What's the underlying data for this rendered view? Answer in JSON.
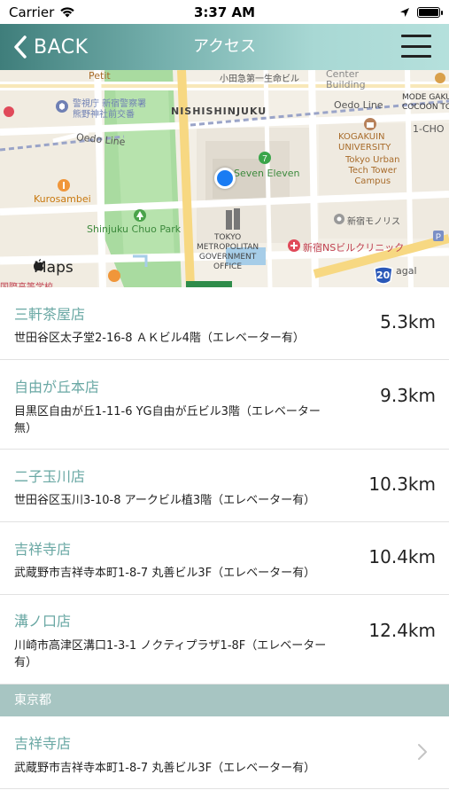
{
  "status_bar": {
    "carrier": "Carrier",
    "time": "3:37 AM"
  },
  "header": {
    "back_label": "BACK",
    "title": "アクセス"
  },
  "map": {
    "labels": {
      "petit": "Petit",
      "odakyu": "小田急第一生命ビル",
      "center_building": "Center\nBuilding",
      "mode_gakuen": "MODE GAKU\nCOCOON TO",
      "keishicho": "警視庁 新宿警察署\n熊野神社前交番",
      "nishishinjuku": "NISHISHINJUKU",
      "oedo_line_top": "Oedo Line",
      "one_cho": "1-CHO",
      "oedo_line_left": "Oedo Line",
      "kogakuin": "KOGAKUIN\nUNIVERSITY",
      "tokyo_urban": "Tokyo Urban\nTech Tower\nCampus",
      "seven_eleven": "Seven Eleven",
      "kurosambei": "Kurosambei",
      "chuo_park": "Shinjuku Chuo Park",
      "monolith": "新宿モノリス",
      "tmg": "TOKYO\nMETROPOLITAN\nGOVERNMENT\nOFFICE",
      "ns_clinic": "新宿NSビルクリニック",
      "agal": "agal",
      "left_bottom": "国際高等学校",
      "route_number": "20"
    },
    "attribution": "Maps"
  },
  "stores": [
    {
      "name": "三軒茶屋店",
      "address": "世田谷区太子堂2-16-8 ＡＫビル4階（エレベーター有）",
      "distance": "5.3km"
    },
    {
      "name": "自由が丘本店",
      "address": "目黒区自由が丘1-11-6 YG自由が丘ビル3階（エレベーター無）",
      "distance": "9.3km"
    },
    {
      "name": "二子玉川店",
      "address": "世田谷区玉川3-10-8 アークビル植3階（エレベーター有）",
      "distance": "10.3km"
    },
    {
      "name": "吉祥寺店",
      "address": "武蔵野市吉祥寺本町1-8-7 丸善ビル3F（エレベーター有）",
      "distance": "10.4km"
    },
    {
      "name": "溝ノ口店",
      "address": "川崎市高津区溝口1-3-1 ノクティプラザ1-8F（エレベーター有）",
      "distance": "12.4km"
    }
  ],
  "section": {
    "title": "東京都"
  },
  "section_stores": [
    {
      "name": "吉祥寺店",
      "address": "武蔵野市吉祥寺本町1-8-7 丸善ビル3F（エレベーター有）"
    }
  ],
  "colors": {
    "accent": "#6aa8a4",
    "section_bg": "#a7c5c2",
    "pin": "#1a7cf3"
  }
}
